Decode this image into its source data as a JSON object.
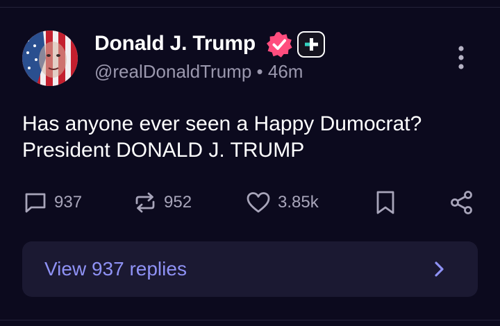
{
  "post": {
    "author_name": "Donald J. Trump",
    "handle": "@realDonaldTrump",
    "separator": "•",
    "time_ago": "46m",
    "text_line1": "Has anyone ever seen a Happy Dumocrat?",
    "text_line2": "President DONALD J. TRUMP"
  },
  "actions": {
    "replies_count": "937",
    "reposts_count": "952",
    "likes_count": "3.85k"
  },
  "replies_button": {
    "label": "View 937 replies"
  },
  "icons": {
    "verified": "verified-badge-icon",
    "plus": "plus-badge-icon",
    "more": "more-vertical-icon",
    "reply": "comment-icon",
    "repost": "repost-icon",
    "like": "heart-icon",
    "bookmark": "bookmark-icon",
    "share": "share-icon",
    "chevron": "chevron-right-icon"
  },
  "colors": {
    "background": "#0c0a1e",
    "verified": "#ff4d7e",
    "accent_text": "#8f92f5",
    "muted_text": "#9b98ae",
    "replies_bg": "#1b1932",
    "plus_teal": "#34d1c0"
  }
}
